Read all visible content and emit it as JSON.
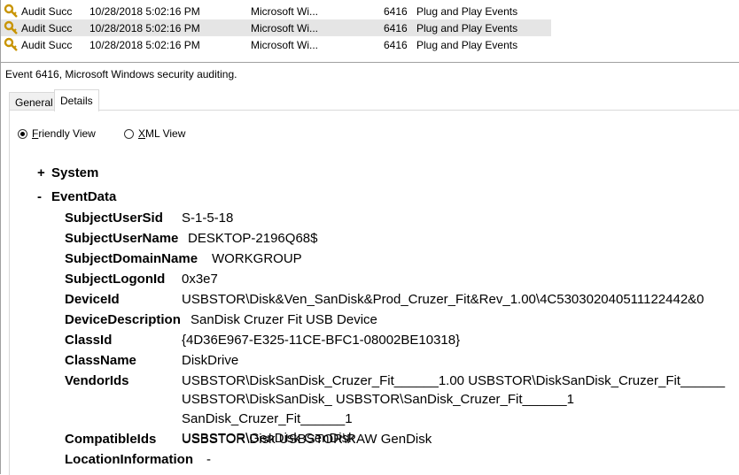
{
  "event_list": {
    "rows": [
      {
        "keywords": "Audit Succ",
        "date": "10/28/2018 5:02:16 PM",
        "source": "Microsoft Wi...",
        "event_id": "6416",
        "category": "Plug and Play Events",
        "selected": false
      },
      {
        "keywords": "Audit Succ",
        "date": "10/28/2018 5:02:16 PM",
        "source": "Microsoft Wi...",
        "event_id": "6416",
        "category": "Plug and Play Events",
        "selected": true
      },
      {
        "keywords": "Audit Succ",
        "date": "10/28/2018 5:02:16 PM",
        "source": "Microsoft Wi...",
        "event_id": "6416",
        "category": "Plug and Play Events",
        "selected": false
      }
    ]
  },
  "event_pane": {
    "title": "Event 6416, Microsoft Windows security auditing.",
    "tabs": [
      {
        "label": "General",
        "active": false
      },
      {
        "label": "Details",
        "active": true
      }
    ],
    "view_options": {
      "friendly": {
        "label_underlined": "F",
        "label_rest": "riendly View",
        "selected": true
      },
      "xml": {
        "label_underlined": "X",
        "label_rest": "ML View",
        "selected": false
      }
    }
  },
  "friendly_view": {
    "system": {
      "toggle": "+",
      "label": "System"
    },
    "event_data": {
      "toggle": "-",
      "label": "EventData"
    },
    "fields": [
      {
        "key": "SubjectUserSid",
        "value": "S-1-5-18"
      },
      {
        "key": "SubjectUserName",
        "value": "DESKTOP-2196Q68$"
      },
      {
        "key": "SubjectDomainName",
        "value": "WORKGROUP"
      },
      {
        "key": "SubjectLogonId",
        "value": "0x3e7"
      },
      {
        "key": "DeviceId",
        "value": "USBSTOR\\Disk&Ven_SanDisk&Prod_Cruzer_Fit&Rev_1.00\\4C530302040511122442&0"
      },
      {
        "key": "DeviceDescription",
        "value": "SanDisk Cruzer Fit USB Device"
      },
      {
        "key": "ClassId",
        "value": "{4D36E967-E325-11CE-BFC1-08002BE10318}"
      },
      {
        "key": "ClassName",
        "value": "DiskDrive"
      },
      {
        "key": "VendorIds",
        "value": "USBSTOR\\DiskSanDisk_Cruzer_Fit______1.00 USBSTOR\\DiskSanDisk_Cruzer_Fit______"
      },
      {
        "key": "CompatibleIds",
        "value": "USBSTOR\\Disk USBSTOR\\RAW GenDisk"
      },
      {
        "key": "LocationInformation",
        "value": "-"
      }
    ],
    "vendor_ids_extra_lines": [
      "USBSTOR\\DiskSanDisk_ USBSTOR\\SanDisk_Cruzer_Fit______1 SanDisk_Cruzer_Fit______1",
      "USBSTOR\\GenDisk GenDisk"
    ]
  }
}
